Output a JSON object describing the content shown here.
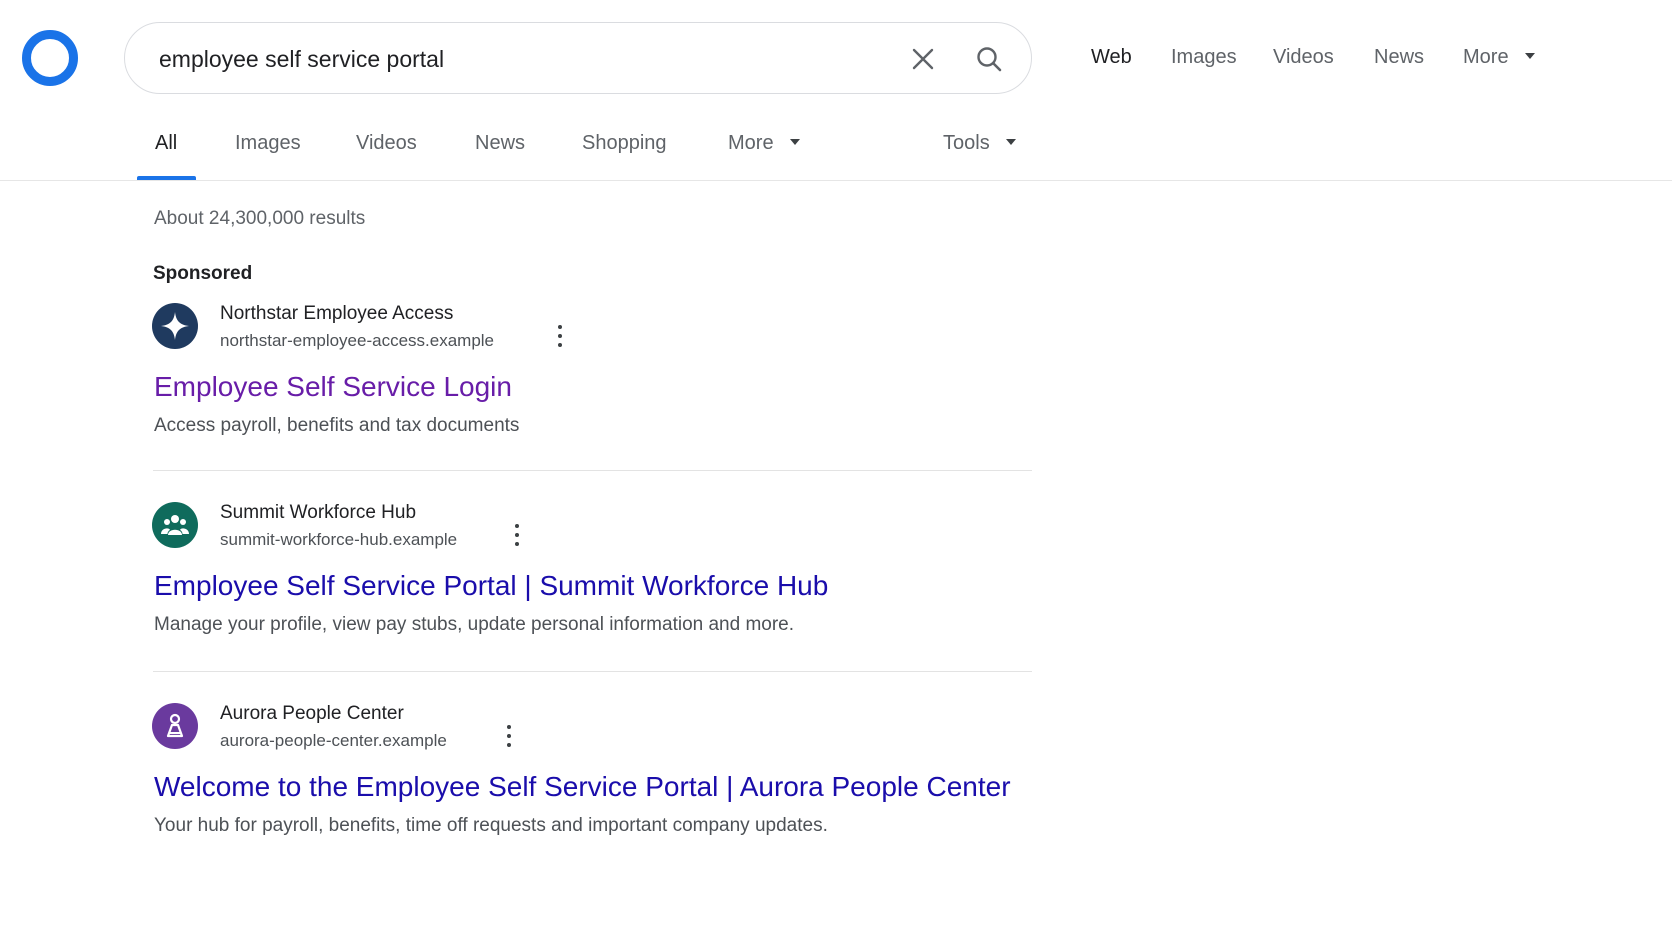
{
  "search": {
    "query": "employee self service portal"
  },
  "topnav": {
    "items": [
      {
        "label": "Web"
      },
      {
        "label": "Images"
      },
      {
        "label": "Videos"
      },
      {
        "label": "News"
      },
      {
        "label": "More"
      }
    ]
  },
  "tabs": {
    "items": [
      {
        "label": "All"
      },
      {
        "label": "Images"
      },
      {
        "label": "Videos"
      },
      {
        "label": "News"
      },
      {
        "label": "Shopping"
      },
      {
        "label": "More"
      }
    ],
    "tools_label": "Tools"
  },
  "results_stats": "About 24,300,000 results",
  "sponsored_label": "Sponsored",
  "results": [
    {
      "site_name": "Northstar Employee Access",
      "url": "northstar-employee-access.example",
      "title": "Employee Self Service Login",
      "snippet": "Access payroll, benefits and tax documents",
      "icon": "star-icon",
      "icon_color": "#1f3a5f",
      "title_color": "#681da8"
    },
    {
      "site_name": "Summit Workforce Hub",
      "url": "summit-workforce-hub.example",
      "title": "Employee Self Service Portal | Summit Workforce Hub",
      "snippet": "Manage your profile, view pay stubs, update personal information and more.",
      "icon": "people-group-icon",
      "icon_color": "#0f6b5c",
      "title_color": "#1a0dab"
    },
    {
      "site_name": "Aurora People Center",
      "url": "aurora-people-center.example",
      "title": "Welcome to the Employee Self Service Portal |  Aurora People Center",
      "snippet": "Your hub for payroll, benefits, time off requests and important company updates.",
      "icon": "person-icon",
      "icon_color": "#6a3a9e",
      "title_color": "#1a0dab"
    }
  ],
  "colors": {
    "accent": "#1a73e8",
    "link": "#1a0dab",
    "visited_link": "#681da8"
  }
}
